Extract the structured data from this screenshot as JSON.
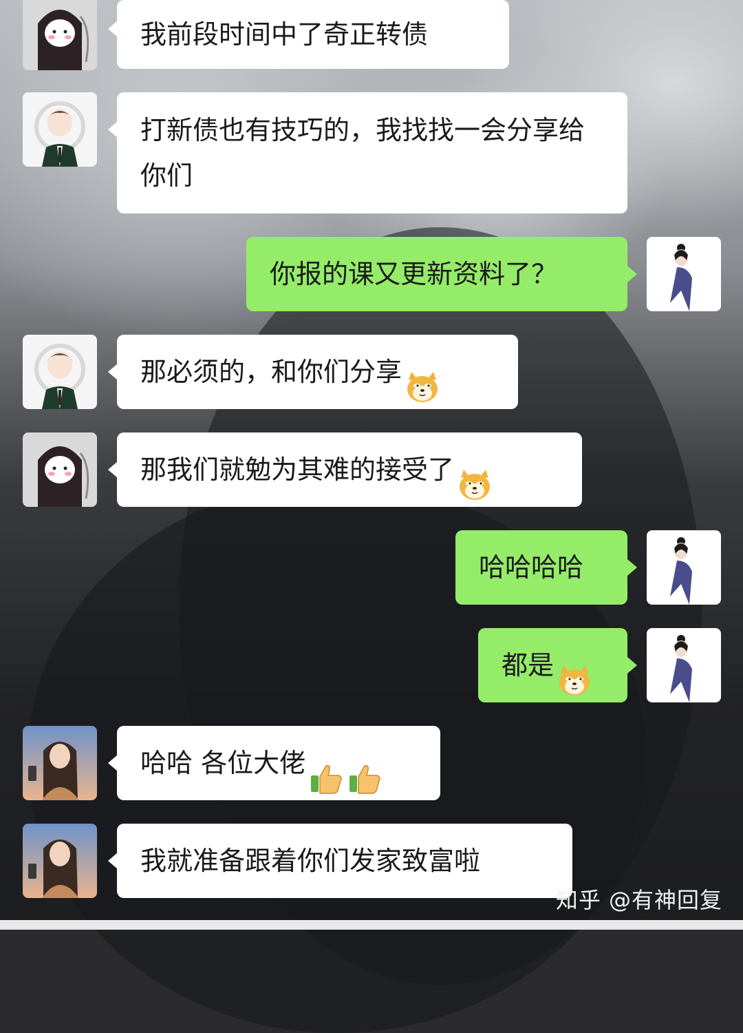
{
  "messages": [
    {
      "side": "left",
      "sender": "reaper",
      "text": "我前段时间中了奇正转债",
      "emojis": []
    },
    {
      "side": "left",
      "sender": "boy",
      "text": "打新债也有技巧的，我找找一会分享给你们",
      "emojis": []
    },
    {
      "side": "right",
      "sender": "me",
      "text": "你报的课又更新资料了？",
      "emojis": []
    },
    {
      "side": "left",
      "sender": "boy",
      "text": "那必须的，和你们分享",
      "emojis": [
        "doge"
      ]
    },
    {
      "side": "left",
      "sender": "reaper",
      "text": "那我们就勉为其难的接受了",
      "emojis": [
        "doge"
      ]
    },
    {
      "side": "right",
      "sender": "me",
      "text": "哈哈哈哈",
      "emojis": []
    },
    {
      "side": "right",
      "sender": "me",
      "text": "都是",
      "emojis": [
        "doge"
      ]
    },
    {
      "side": "left",
      "sender": "girl",
      "text": "哈哈 各位大佬",
      "emojis": [
        "thumbs-up",
        "thumbs-up"
      ]
    },
    {
      "side": "left",
      "sender": "girl",
      "text": "我就准备跟着你们发家致富啦",
      "emojis": []
    }
  ],
  "watermark": "知乎 @有神回复",
  "colors": {
    "own_bubble": "#95ec69",
    "other_bubble": "#ffffff",
    "text": "#1a1a1a"
  }
}
